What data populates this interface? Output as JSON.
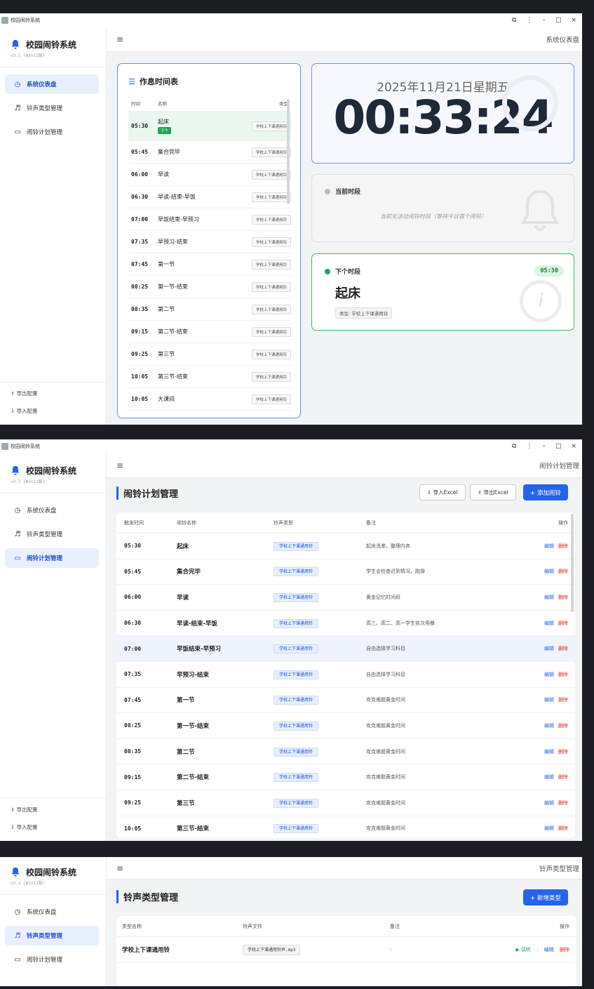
{
  "app": {
    "window_title": "校园闹铃系统",
    "brand": "校园闹铃系统",
    "version": "v3.1 (Win11版)"
  },
  "window_controls": {
    "restore": "⧉",
    "menu": "⋮",
    "minimize": "–",
    "maximize": "□",
    "close": "×"
  },
  "nav": [
    {
      "label": "系统仪表盘",
      "icon": "clock-icon"
    },
    {
      "label": "铃声类型管理",
      "icon": "music-note-icon"
    },
    {
      "label": "闹铃计划管理",
      "icon": "calendar-icon"
    }
  ],
  "sidebar_footer": {
    "export": "导出配置",
    "import": "导入配置"
  },
  "dashboard": {
    "breadcrumb": "系统仪表盘",
    "schedule_title": "作息时间表",
    "columns": {
      "time": "时间",
      "name": "名称",
      "type": "类型"
    },
    "rows": [
      {
        "time": "05:30",
        "name": "起床",
        "type": "学校上下课通用铃",
        "badge": "下个"
      },
      {
        "time": "05:45",
        "name": "集合完毕",
        "type": "学校上下课通用铃"
      },
      {
        "time": "06:00",
        "name": "早读",
        "type": "学校上下课通用铃"
      },
      {
        "time": "06:30",
        "name": "早读-结束-早饭",
        "type": "学校上下课通用铃"
      },
      {
        "time": "07:00",
        "name": "早饭结束-早预习",
        "type": "学校上下课通用铃"
      },
      {
        "time": "07:35",
        "name": "早预习-结束",
        "type": "学校上下课通用铃"
      },
      {
        "time": "07:45",
        "name": "第一节",
        "type": "学校上下课通用铃"
      },
      {
        "time": "08:25",
        "name": "第一节-结束",
        "type": "学校上下课通用铃"
      },
      {
        "time": "08:35",
        "name": "第二节",
        "type": "学校上下课通用铃"
      },
      {
        "time": "09:15",
        "name": "第二节-结束",
        "type": "学校上下课通用铃"
      },
      {
        "time": "09:25",
        "name": "第三节",
        "type": "学校上下课通用铃"
      },
      {
        "time": "10:05",
        "name": "第三节-结束",
        "type": "学校上下课通用铃"
      },
      {
        "time": "10:05",
        "name": "大课间",
        "type": "学校上下课通用铃"
      }
    ],
    "date": "2025年11月21日星期五",
    "time": "00:33:24",
    "current": {
      "title": "当前时段",
      "message": "当前无活动闹铃时段（等待今日首个闹铃）"
    },
    "next": {
      "title": "下个时段",
      "time": "05:30",
      "name": "起床",
      "type_label": "类型: 学校上下课通用铃"
    }
  },
  "plans": {
    "breadcrumb": "闹铃计划管理",
    "title": "闹铃计划管理",
    "import_btn": "导入Excel",
    "export_btn": "导出Excel",
    "add_btn": "+ 添加闹铃",
    "columns": {
      "time": "触发时间",
      "name": "闹铃名称",
      "type": "铃声类型",
      "remark": "备注",
      "ops": "操作"
    },
    "edit": "编辑",
    "delete": "删除",
    "rows": [
      {
        "time": "05:30",
        "name": "起床",
        "type": "学校上下课通用铃",
        "remark": "起床洗漱，整理内务"
      },
      {
        "time": "05:45",
        "name": "集合完毕",
        "type": "学校上下课通用铃",
        "remark": "学生会检查迟到情况，跑操"
      },
      {
        "time": "06:00",
        "name": "早读",
        "type": "学校上下课通用铃",
        "remark": "黄金记忆时间段"
      },
      {
        "time": "06:30",
        "name": "早读-结束-早饭",
        "type": "学校上下课通用铃",
        "remark": "高三、高二、高一学生依次用餐"
      },
      {
        "time": "07:00",
        "name": "早饭结束-早预习",
        "type": "学校上下课通用铃",
        "remark": "自由选择学习科目"
      },
      {
        "time": "07:35",
        "name": "早预习-结束",
        "type": "学校上下课通用铃",
        "remark": "自由选择学习科目"
      },
      {
        "time": "07:45",
        "name": "第一节",
        "type": "学校上下课通用铃",
        "remark": "攻克难题黄金时间"
      },
      {
        "time": "08:25",
        "name": "第一节-结束",
        "type": "学校上下课通用铃",
        "remark": "攻克难题黄金时间"
      },
      {
        "time": "08:35",
        "name": "第二节",
        "type": "学校上下课通用铃",
        "remark": "攻克难题黄金时间"
      },
      {
        "time": "09:15",
        "name": "第二节-结束",
        "type": "学校上下课通用铃",
        "remark": "攻克难题黄金时间"
      },
      {
        "time": "09:25",
        "name": "第三节",
        "type": "学校上下课通用铃",
        "remark": "攻克难题黄金时间"
      },
      {
        "time": "10:05",
        "name": "第三节-结束",
        "type": "学校上下课通用铃",
        "remark": "攻克难题黄金时间"
      }
    ]
  },
  "types": {
    "breadcrumb": "铃声类型管理",
    "title": "铃声类型管理",
    "add_btn": "+ 新增类型",
    "columns": {
      "name": "类型名称",
      "file": "铃声文件",
      "remark": "备注",
      "ops": "操作"
    },
    "rows": [
      {
        "name": "学校上下课通用铃",
        "file": "学校上下课通用铃声.mp3",
        "remark": "-",
        "play": "▶ 试听",
        "sep": "|",
        "edit": "编辑",
        "delete": "删除"
      }
    ]
  },
  "colors": {
    "accent": "#2563eb",
    "green": "#22a559",
    "danger": "#dc2626"
  }
}
